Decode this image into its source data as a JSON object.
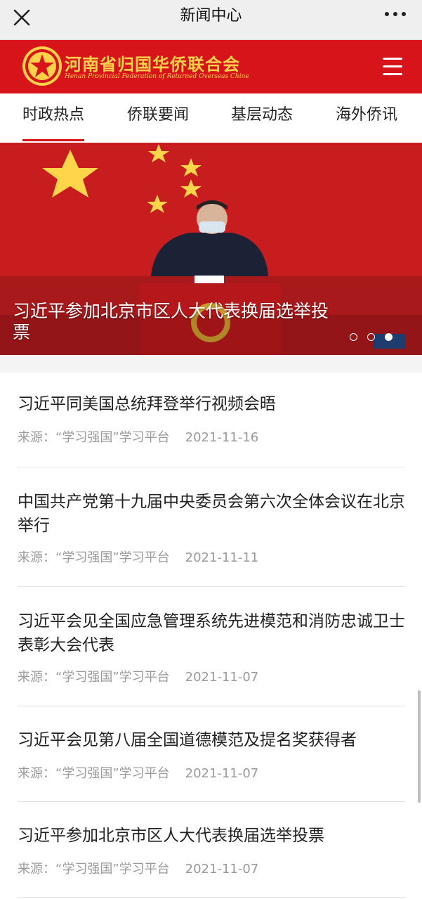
{
  "topbar": {
    "title": "新闻中心"
  },
  "header": {
    "brand_cn": "河南省归国华侨联合会",
    "brand_en": "Henan Provincial Federation of Returned Overseas Chinese"
  },
  "tabs": [
    "时政热点",
    "侨联要闻",
    "基层动态",
    "海外侨讯"
  ],
  "banner": {
    "caption": "习近平参加北京市区人大代表换届选举投票",
    "slide_count": 3,
    "active_slide": 3
  },
  "news": [
    {
      "title": "习近平同美国总统拜登举行视频会晤",
      "source": "来源：“学习强国”学习平台",
      "date": "2021-11-16"
    },
    {
      "title": "中国共产党第十九届中央委员会第六次全体会议在北京举行",
      "source": "来源：“学习强国”学习平台",
      "date": "2021-11-11"
    },
    {
      "title": "习近平会见全国应急管理系统先进模范和消防忠诚卫士表彰大会代表",
      "source": "来源：“学习强国”学习平台",
      "date": "2021-11-07"
    },
    {
      "title": "习近平会见第八届全国道德模范及提名奖获得者",
      "source": "来源：“学习强国”学习平台",
      "date": "2021-11-07"
    },
    {
      "title": "习近平参加北京市区人大代表换届选举投票",
      "source": "来源：“学习强国”学习平台",
      "date": "2021-11-07"
    }
  ],
  "colors": {
    "brand_red": "#d8141b",
    "brand_gold": "#ffd24a",
    "meta_gray": "#9a9a9a"
  }
}
